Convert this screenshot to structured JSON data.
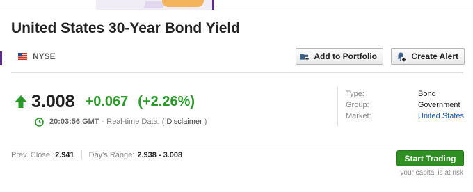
{
  "header": {
    "title": "United States 30-Year Bond Yield"
  },
  "exchange": {
    "name": "NYSE",
    "flag_icon": "us-flag-icon"
  },
  "actions": {
    "add_to_portfolio": "Add to Portfolio",
    "add_to_portfolio_icon": "folder-plus-icon",
    "create_alert": "Create Alert",
    "create_alert_icon": "bell-plus-icon"
  },
  "quote": {
    "direction_icon": "up-arrow-icon",
    "last": "3.008",
    "change": "+0.067",
    "change_pct": "(+2.26%)",
    "change_color": "#2b9a2b",
    "clock_icon": "clock-icon",
    "time": "20:03:56 GMT",
    "time_note_prefix": "- Real-time Data. (",
    "disclaimer": "Disclaimer",
    "time_note_suffix": ")"
  },
  "info": [
    {
      "key": "Type:",
      "value": "Bond"
    },
    {
      "key": "Group:",
      "value": "Government"
    },
    {
      "key": "Market:",
      "value": "United States"
    }
  ],
  "stats": {
    "prev_close_label": "Prev. Close:",
    "prev_close_value": "2.941",
    "days_range_label": "Day's Range:",
    "days_range_value": "2.938 - 3.008"
  },
  "trading": {
    "button_label": "Start Trading",
    "button_color": "#2f8f23",
    "risk_note": "your capital is at risk"
  },
  "colors": {
    "accent_purple": "#5a2a8c",
    "link_blue": "#1a5aa8"
  }
}
